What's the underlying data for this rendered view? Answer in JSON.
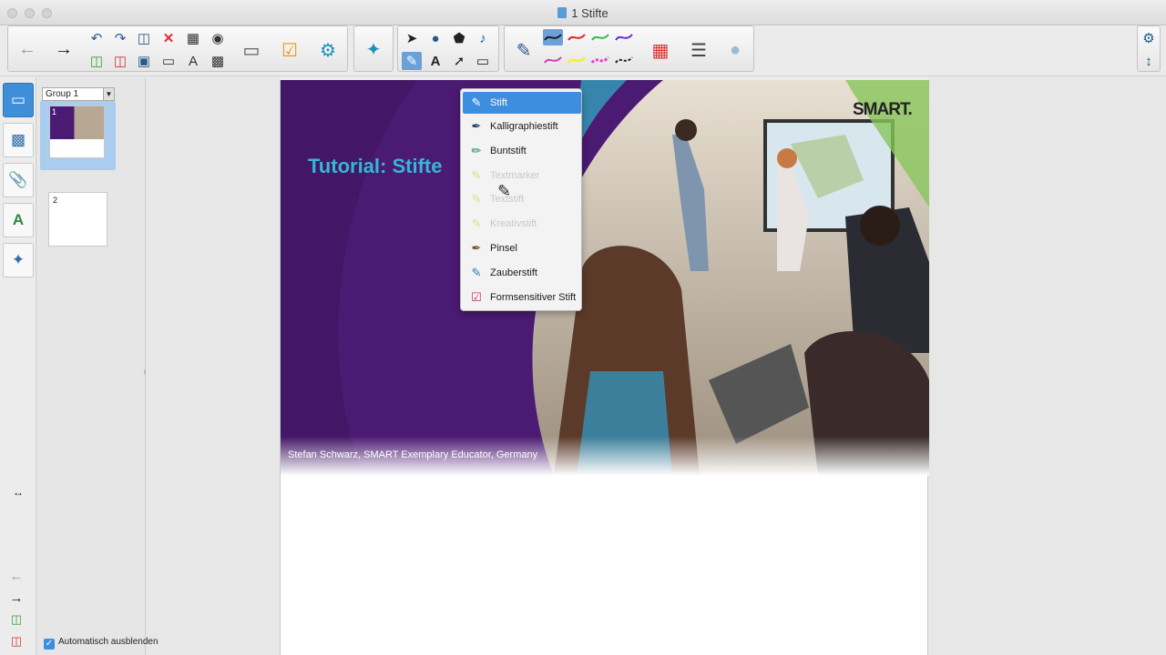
{
  "window": {
    "title": "1 Stifte"
  },
  "toolbar": {
    "back": "back-arrow-icon",
    "forward": "forward-arrow-icon",
    "pen_colors": [
      "#1a1a1a",
      "#e02020",
      "#35b84a",
      "#6a2bd6",
      "#d63ab8",
      "#f5f03a",
      "#e83dd0",
      "#1a1a1a"
    ]
  },
  "sorter": {
    "group_label": "Group 1",
    "pages": [
      {
        "number": "1"
      },
      {
        "number": "2"
      }
    ]
  },
  "slide": {
    "title": "Tutorial: Stifte",
    "credit": "Stefan Schwarz, SMART Exemplary Educator, Germany",
    "logo": "SMART."
  },
  "pen_menu": {
    "items": [
      {
        "label": "Stift",
        "state": "selected"
      },
      {
        "label": "Kalligraphiestift",
        "state": "normal"
      },
      {
        "label": "Buntstift",
        "state": "normal"
      },
      {
        "label": "Textmarker",
        "state": "dim"
      },
      {
        "label": "Textstift",
        "state": "dim"
      },
      {
        "label": "Kreativstift",
        "state": "dim"
      },
      {
        "label": "Pinsel",
        "state": "normal"
      },
      {
        "label": "Zauberstift",
        "state": "normal"
      },
      {
        "label": "Formsensitiver Stift",
        "state": "normal"
      }
    ]
  },
  "footer": {
    "autohide_label": "Automatisch ausblenden"
  }
}
